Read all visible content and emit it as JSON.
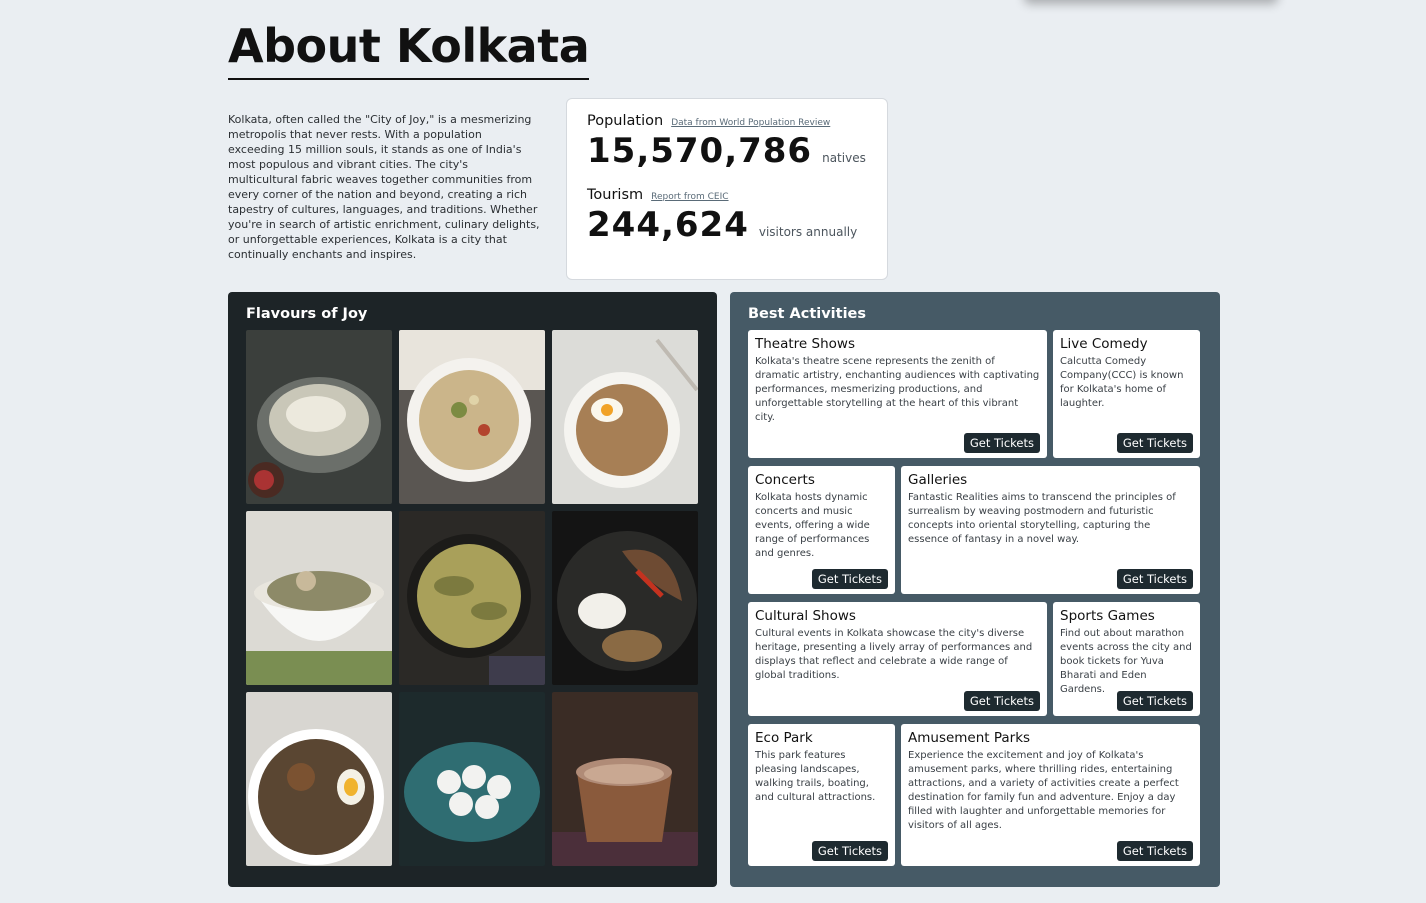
{
  "page": {
    "title": "About Kolkata",
    "intro": "Kolkata, often called the \"City of Joy,\" is a mesmerizing metropolis that never rests. With a population exceeding 15 million souls, it stands as one of India's most populous and vibrant cities. The city's multicultural fabric weaves together communities from every corner of the nation and beyond, creating a rich tapestry of cultures, languages, and traditions. Whether you're in search of artistic enrichment, culinary delights, or unforgettable experiences, Kolkata is a city that continually enchants and inspires."
  },
  "stats": {
    "population": {
      "label": "Population",
      "source": "Data from World Population Review",
      "value": "15,570,786",
      "unit": "natives"
    },
    "tourism": {
      "label": "Tourism",
      "source": "Report from CEIC",
      "value": "244,624",
      "unit": "visitors annually"
    }
  },
  "food": {
    "title": "Flavours of Joy"
  },
  "activities": {
    "title": "Best Activities",
    "button_label": "Get Tickets",
    "items": [
      {
        "title": "Theatre Shows",
        "desc": "Kolkata's theatre scene represents the zenith of dramatic artistry, enchanting audiences with captivating performances, mesmerizing productions, and unforgettable storytelling at the heart of this vibrant city."
      },
      {
        "title": "Live Comedy",
        "desc": "Calcutta Comedy Company(CCC) is known for Kolkata's home of laughter."
      },
      {
        "title": "Concerts",
        "desc": "Kolkata hosts dynamic concerts and music events, offering a wide range of performances and genres."
      },
      {
        "title": "Galleries",
        "desc": "Fantastic Realities aims to transcend the principles of surrealism by weaving postmodern and futuristic concepts into oriental storytelling, capturing the essence of fantasy in a novel way."
      },
      {
        "title": "Cultural Shows",
        "desc": "Cultural events in Kolkata showcase the city's diverse heritage, presenting a lively array of performances and displays that reflect and celebrate a wide range of global traditions."
      },
      {
        "title": "Sports Games",
        "desc": "Find out about marathon events across the city and book tickets for Yuva Bharati and Eden Gardens."
      },
      {
        "title": "Eco Park",
        "desc": "This park features pleasing landscapes, walking trails, boating, and cultural attractions."
      },
      {
        "title": "Amusement Parks",
        "desc": "Experience the excitement and joy of Kolkata's amusement parks, where thrilling rides, entertaining attractions, and a variety of activities create a perfect destination for family fun and adventure. Enjoy a day filled with laughter and unforgettable memories for visitors of all ages."
      }
    ]
  }
}
